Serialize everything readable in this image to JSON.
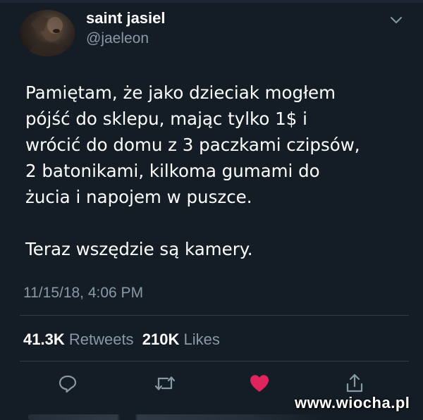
{
  "tweet": {
    "display_name": "saint jasiel",
    "handle": "@jaeleon",
    "text": "Pamiętam, że jako dzieciak mogłem\npójść do sklepu, mając tylko 1$ i\nwrócić do domu z 3 paczkami czipsów,\n2 batonikami, kilkoma gumami do\nżucia i napojem w puszce.\n\nTeraz wszędzie są kamery.",
    "timestamp": "11/15/18, 4:06 PM",
    "retweets_count": "41.3K",
    "retweets_label": "Retweets",
    "likes_count": "210K",
    "likes_label": "Likes"
  },
  "actions": {
    "reply_icon": "reply-icon",
    "retweet_icon": "retweet-icon",
    "like_icon": "heart-icon",
    "share_icon": "share-icon",
    "like_color": "#e0245e",
    "icon_color": "#8899a6"
  },
  "colors": {
    "background": "#141d26",
    "text": "#ffffff",
    "muted": "#8899a6",
    "divider": "#2f3d4b"
  },
  "watermark": "www.wiocha.pl"
}
